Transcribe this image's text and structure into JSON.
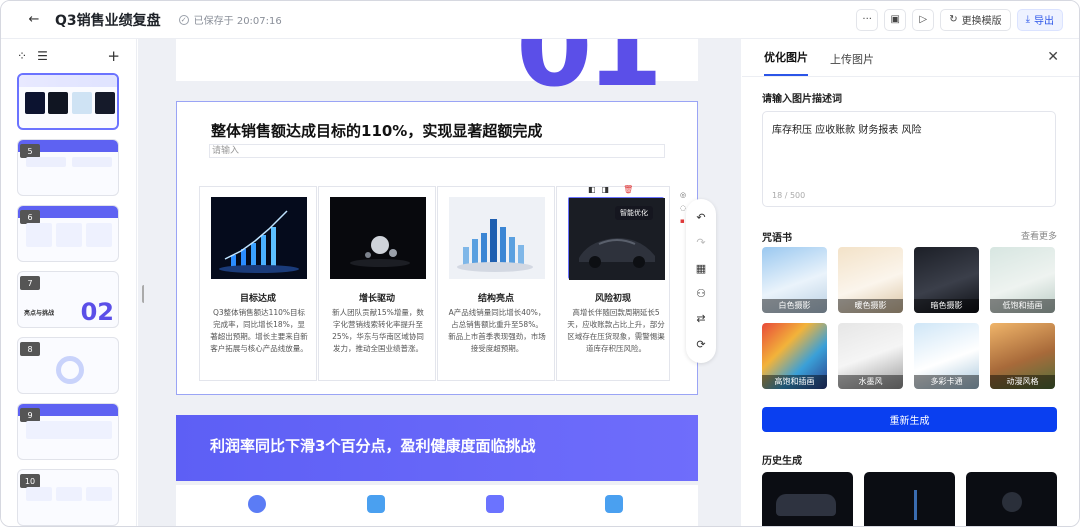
{
  "header": {
    "title": "Q3销售业绩复盘",
    "saved_text": "已保存于 20:07:16",
    "template_label": "更换模版",
    "export_label": "导出"
  },
  "sidebar": {
    "slides": [
      {
        "num": "",
        "active": true
      },
      {
        "num": "5"
      },
      {
        "num": "6"
      },
      {
        "num": "7",
        "text": "亮点与挑战",
        "big": "02"
      },
      {
        "num": "8"
      },
      {
        "num": "9"
      },
      {
        "num": "10"
      }
    ]
  },
  "slide": {
    "title": "整体销售额达成目标的110%，实现显著超额完成",
    "input_placeholder": "请输入",
    "smart_badge": "智能优化",
    "cards": [
      {
        "title": "目标达成",
        "desc": "Q3整体销售额达110%目标完成率，同比增长18%，显著超出预期。增长主要来自新客户拓展与核心产品线放量。"
      },
      {
        "title": "增长驱动",
        "desc": "新人团队贡献15%增量，数字化营销线索转化率提升至25%，华东与华南区域协同发力，推动全国业绩普涨。"
      },
      {
        "title": "结构亮点",
        "desc": "A产品线销量同比增长40%，占总销售额比重升至58%。新品上市首季表现强劲，市场接受度超预期。"
      },
      {
        "title": "风险初现",
        "desc": "高增长伴随回款周期延长5天，应收账款占比上升，部分区域存在压货现象，需警惕渠道库存积压风险。"
      }
    ],
    "banner_title": "利润率同比下滑3个百分点，盈利健康度面临挑战"
  },
  "panel": {
    "tabs": [
      "优化图片",
      "上传图片"
    ],
    "desc_label": "请输入图片描述词",
    "desc_value": "库存积压 应收账款 财务报表 风险",
    "desc_count": "18 / 500",
    "spell_label": "咒语书",
    "more_label": "查看更多",
    "styles": [
      "白色摄影",
      "暖色摄影",
      "暗色摄影",
      "低饱和插画",
      "高饱和插画",
      "水墨风",
      "多彩卡通",
      "动漫风格"
    ],
    "regen_label": "重新生成",
    "history_label": "历史生成"
  }
}
